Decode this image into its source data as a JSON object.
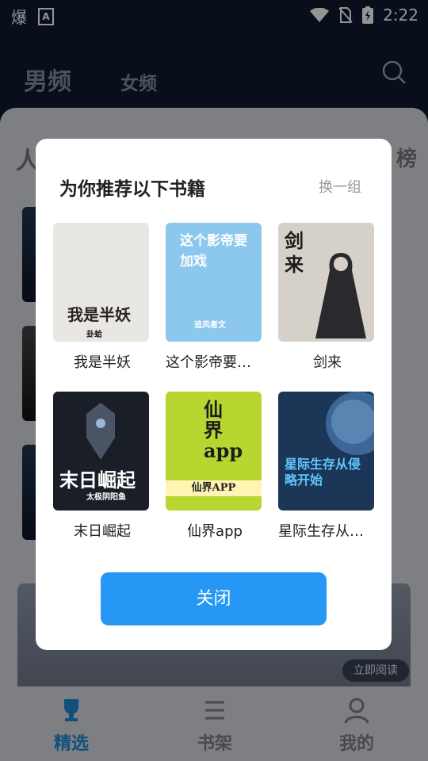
{
  "status": {
    "left_icons": [
      "app-icon-bao",
      "a-notification-icon"
    ],
    "right_icons": [
      "wifi-icon",
      "no-sim-icon",
      "battery-charging-icon"
    ],
    "time": "2:22",
    "app_glyph": "爆",
    "a_glyph": "A"
  },
  "nav": {
    "tab_male": "男频",
    "tab_female": "女频",
    "search_icon": "search-icon"
  },
  "content": {
    "section_title": "人",
    "section_right": "榜",
    "banner_button": "立即阅读"
  },
  "dialog": {
    "title": "为你推荐以下书籍",
    "refresh": "换一组",
    "close": "关闭",
    "books": [
      {
        "title": "我是半妖",
        "cover_text": "我是半妖",
        "cover_sub": "卦蛤",
        "cover_bg": "#e9e7e1",
        "cover_color": "#2a2323"
      },
      {
        "title": "这个影帝要加…",
        "cover_text": "这个影帝要加戏",
        "cover_sub": "追风者文",
        "cover_bg": "#8cc8ee",
        "cover_color": "#ffffff"
      },
      {
        "title": "剑来",
        "cover_text": "剑来",
        "cover_sub": "",
        "cover_bg": "#d6d1c8",
        "cover_color": "#1b1b1b"
      },
      {
        "title": "末日崛起",
        "cover_text": "末日崛起",
        "cover_sub": "太极阴阳鱼",
        "cover_bg": "#1a1f27",
        "cover_color": "#ffffff"
      },
      {
        "title": "仙界app",
        "cover_text": "仙界app",
        "cover_sub": "仙界APP",
        "cover_bg": "#b7d62f",
        "cover_color": "#1d1d1d"
      },
      {
        "title": "星际生存从侵…",
        "cover_text": "星际生存从侵略开始",
        "cover_sub": "",
        "cover_bg": "#1c3657",
        "cover_color": "#5dc7ff"
      }
    ]
  },
  "bottom_nav": {
    "items": [
      "精选",
      "书架",
      "我的"
    ],
    "active_color": "#1f8bd6",
    "inactive_color": "#7a7f87"
  }
}
